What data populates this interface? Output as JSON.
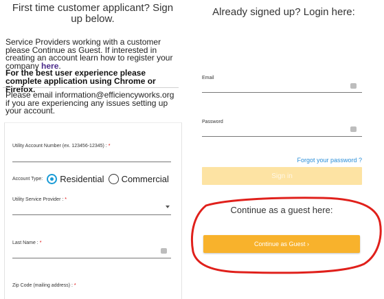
{
  "signup": {
    "title": "First time customer applicant? Sign up below.",
    "notice_text": "Service Providers working with a customer please Continue as Guest.  If interested in creating an account learn how to register your company ",
    "notice_link": "here",
    "notice_end": ".",
    "browser_notice": "For the best user experience please complete application using Chrome or Firefox.",
    "support_notice": "Please email information@efficiencyworks.org if you are experiencing any issues setting up your account.",
    "form": {
      "utility_account_label": "Utility Account Number (ex. 123456-12345) :",
      "account_type_label": "Account Type:",
      "account_type_options": [
        "Residential",
        "Commercial"
      ],
      "account_type_selected": "Residential",
      "utility_provider_label": "Utility Service Provider :",
      "last_name_label": "Last Name :",
      "zip_label": "Zip Code (mailing address) :",
      "required_marker": "*"
    }
  },
  "login": {
    "title": "Already signed up? Login here:",
    "email_label": "Email",
    "password_label": "Password",
    "forgot_password": "Forgot your password ?",
    "sign_in": "Sign in"
  },
  "guest": {
    "title": "Continue as a guest here:",
    "button": "Continue as Guest",
    "button_chevron": "›",
    "highlight_color": "#e0201b"
  },
  "colors": {
    "accent_orange": "#f8b22c",
    "disabled_orange": "#fde3a3",
    "link_blue": "#2a8ed8",
    "radio_blue": "#1a9bd6"
  }
}
